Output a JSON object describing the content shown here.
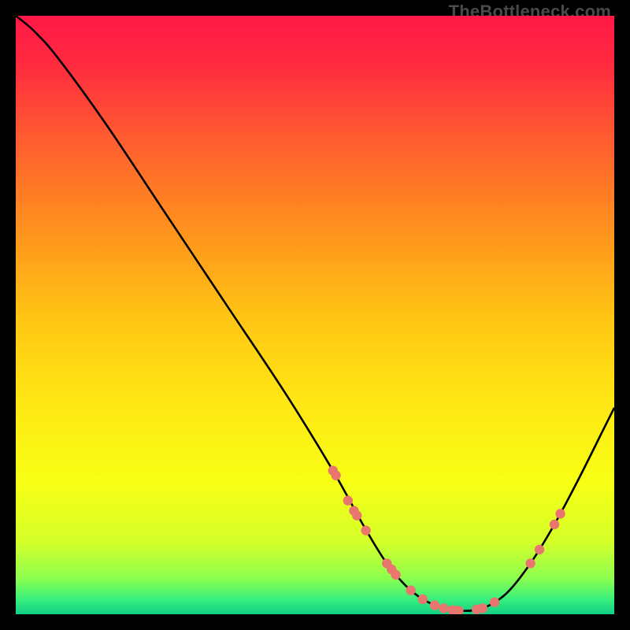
{
  "watermark": "TheBottleneck.com",
  "chart_data": {
    "type": "line",
    "title": "",
    "xlabel": "",
    "ylabel": "",
    "xlim": [
      0,
      100
    ],
    "ylim": [
      0,
      100
    ],
    "gradient_stops": [
      {
        "offset": 0.0,
        "color": "#ff1846"
      },
      {
        "offset": 0.08,
        "color": "#ff2a3f"
      },
      {
        "offset": 0.2,
        "color": "#ff5a30"
      },
      {
        "offset": 0.35,
        "color": "#ff8f1e"
      },
      {
        "offset": 0.5,
        "color": "#ffc414"
      },
      {
        "offset": 0.65,
        "color": "#ffe814"
      },
      {
        "offset": 0.78,
        "color": "#f7ff14"
      },
      {
        "offset": 0.88,
        "color": "#d4ff2a"
      },
      {
        "offset": 0.94,
        "color": "#8cff4e"
      },
      {
        "offset": 0.975,
        "color": "#38ef7d"
      },
      {
        "offset": 1.0,
        "color": "#11d084"
      }
    ],
    "curve": [
      {
        "x": 0.0,
        "y": 100.0
      },
      {
        "x": 3.0,
        "y": 97.5
      },
      {
        "x": 7.0,
        "y": 93.0
      },
      {
        "x": 15.0,
        "y": 82.0
      },
      {
        "x": 25.0,
        "y": 67.0
      },
      {
        "x": 35.0,
        "y": 52.0
      },
      {
        "x": 45.0,
        "y": 37.0
      },
      {
        "x": 53.0,
        "y": 24.0
      },
      {
        "x": 58.0,
        "y": 15.0
      },
      {
        "x": 62.0,
        "y": 8.5
      },
      {
        "x": 66.0,
        "y": 4.0
      },
      {
        "x": 70.0,
        "y": 1.5
      },
      {
        "x": 74.0,
        "y": 0.6
      },
      {
        "x": 78.0,
        "y": 1.0
      },
      {
        "x": 82.0,
        "y": 3.5
      },
      {
        "x": 86.0,
        "y": 8.5
      },
      {
        "x": 90.0,
        "y": 15.0
      },
      {
        "x": 94.0,
        "y": 22.5
      },
      {
        "x": 98.0,
        "y": 30.5
      },
      {
        "x": 100.0,
        "y": 34.5
      }
    ],
    "markers": [
      {
        "x": 53.0,
        "y": 24.0
      },
      {
        "x": 53.5,
        "y": 23.2
      },
      {
        "x": 55.5,
        "y": 19.0
      },
      {
        "x": 56.5,
        "y": 17.3
      },
      {
        "x": 57.0,
        "y": 16.5
      },
      {
        "x": 58.5,
        "y": 14.0
      },
      {
        "x": 62.0,
        "y": 8.5
      },
      {
        "x": 62.8,
        "y": 7.5
      },
      {
        "x": 63.5,
        "y": 6.6
      },
      {
        "x": 66.0,
        "y": 4.0
      },
      {
        "x": 68.0,
        "y": 2.5
      },
      {
        "x": 70.0,
        "y": 1.5
      },
      {
        "x": 71.5,
        "y": 1.0
      },
      {
        "x": 73.0,
        "y": 0.7
      },
      {
        "x": 74.0,
        "y": 0.6
      },
      {
        "x": 77.0,
        "y": 0.8
      },
      {
        "x": 78.0,
        "y": 1.0
      },
      {
        "x": 80.0,
        "y": 2.0
      },
      {
        "x": 86.0,
        "y": 8.5
      },
      {
        "x": 87.5,
        "y": 10.8
      },
      {
        "x": 90.0,
        "y": 15.0
      },
      {
        "x": 91.0,
        "y": 16.8
      }
    ],
    "marker_color": "#e9766e",
    "curve_color": "#000000"
  }
}
